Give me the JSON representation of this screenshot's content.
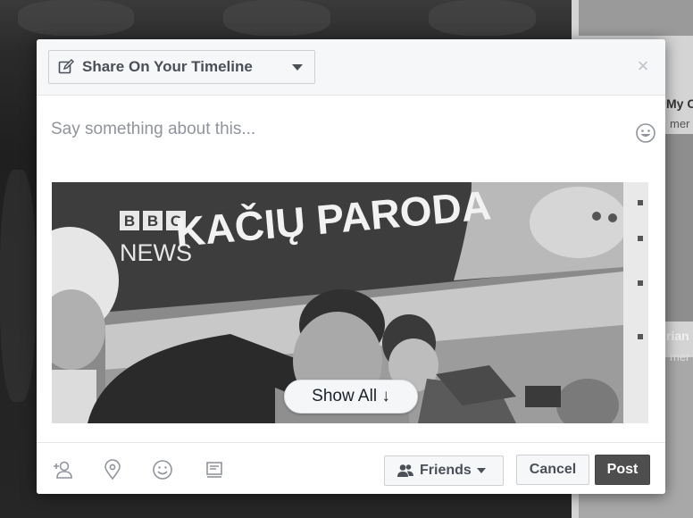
{
  "header": {
    "share_target_label": "Share On Your Timeline",
    "close_glyph": "×"
  },
  "composer": {
    "placeholder": "Say something about this..."
  },
  "attachment": {
    "banner_text": "KAČIŲ PARODA",
    "logo_letters": [
      "B",
      "B",
      "C"
    ],
    "logo_sub": "NEWS",
    "show_all_label": "Show All ↓"
  },
  "footer": {
    "audience_label": "Friends",
    "cancel_label": "Cancel",
    "post_label": "Post"
  },
  "background": {
    "side_text_1": "My C",
    "side_text_2": "mer",
    "side_text_3": "rian",
    "side_text_4": "mer"
  },
  "icons": {
    "header": [
      "edit-icon",
      "chevron-down-icon",
      "close-icon"
    ],
    "composer": [
      "emoji-icon"
    ],
    "footer": [
      "tag-friends-icon",
      "location-icon",
      "feeling-icon",
      "sticker-icon",
      "friends-icon",
      "chevron-down-icon"
    ]
  },
  "colors": {
    "post_button": "#4e4e4e",
    "header_bg": "#f6f7f9",
    "button_border": "#ced0d4"
  }
}
